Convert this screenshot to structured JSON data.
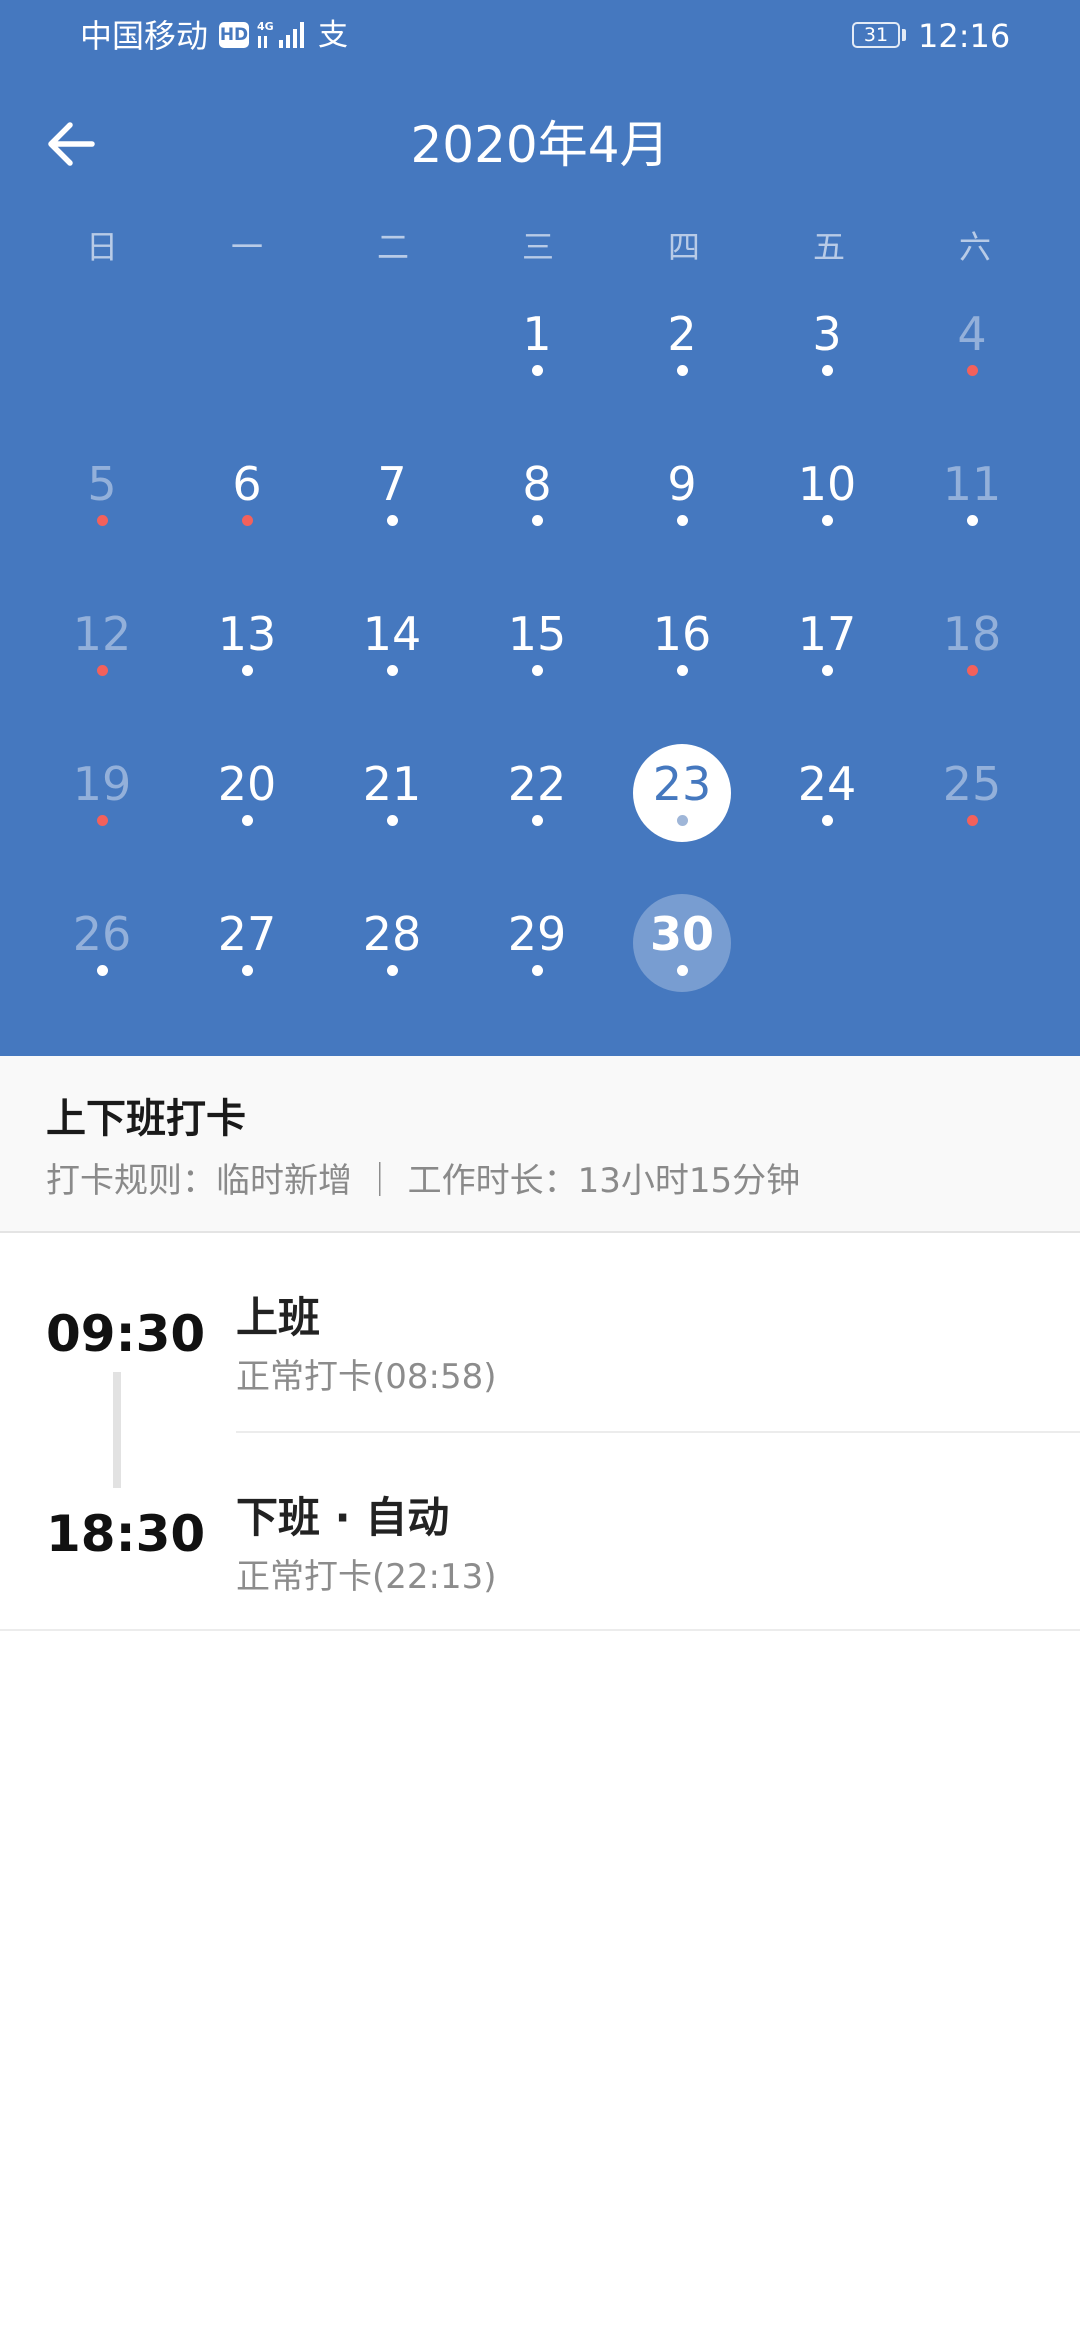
{
  "status_bar": {
    "carrier": "中国移动",
    "hd": "HD",
    "pay_icon": "支",
    "battery": "31",
    "time": "12:16"
  },
  "header": {
    "back_icon": "arrow-left-icon",
    "title": "2020年4月"
  },
  "calendar": {
    "weekdays": [
      "日",
      "一",
      "二",
      "三",
      "四",
      "五",
      "六"
    ],
    "days": [
      {
        "day": "1",
        "dot": "white"
      },
      {
        "day": "2",
        "dot": "white"
      },
      {
        "day": "3",
        "dot": "white"
      },
      {
        "day": "4",
        "dot": "red"
      },
      {
        "day": "5",
        "dot": "red"
      },
      {
        "day": "6",
        "dot": "red"
      },
      {
        "day": "7",
        "dot": "white"
      },
      {
        "day": "8",
        "dot": "white"
      },
      {
        "day": "9",
        "dot": "white"
      },
      {
        "day": "10",
        "dot": "white"
      },
      {
        "day": "11",
        "dot": "white"
      },
      {
        "day": "12",
        "dot": "red"
      },
      {
        "day": "13",
        "dot": "white"
      },
      {
        "day": "14",
        "dot": "white"
      },
      {
        "day": "15",
        "dot": "white"
      },
      {
        "day": "16",
        "dot": "white"
      },
      {
        "day": "17",
        "dot": "white"
      },
      {
        "day": "18",
        "dot": "red"
      },
      {
        "day": "19",
        "dot": "red"
      },
      {
        "day": "20",
        "dot": "white"
      },
      {
        "day": "21",
        "dot": "white"
      },
      {
        "day": "22",
        "dot": "white"
      },
      {
        "day": "23",
        "dot": "white",
        "selected": true
      },
      {
        "day": "24",
        "dot": "white"
      },
      {
        "day": "25",
        "dot": "red"
      },
      {
        "day": "26",
        "dot": "white"
      },
      {
        "day": "27",
        "dot": "white"
      },
      {
        "day": "28",
        "dot": "white"
      },
      {
        "day": "29",
        "dot": "white"
      },
      {
        "day": "30",
        "dot": "white",
        "today": true
      }
    ]
  },
  "colors": {
    "header_bg": "#4578bf",
    "red_dot": "#f2615c"
  },
  "summary": {
    "title": "上下班打卡",
    "rule": "打卡规则：临时新增 ｜ 工作时长：13小时15分钟"
  },
  "records": [
    {
      "time": "09:30",
      "label": "上班",
      "detail": "正常打卡(08:58)"
    },
    {
      "time": "18:30",
      "label": "下班 · 自动",
      "detail": "正常打卡(22:13)"
    }
  ]
}
